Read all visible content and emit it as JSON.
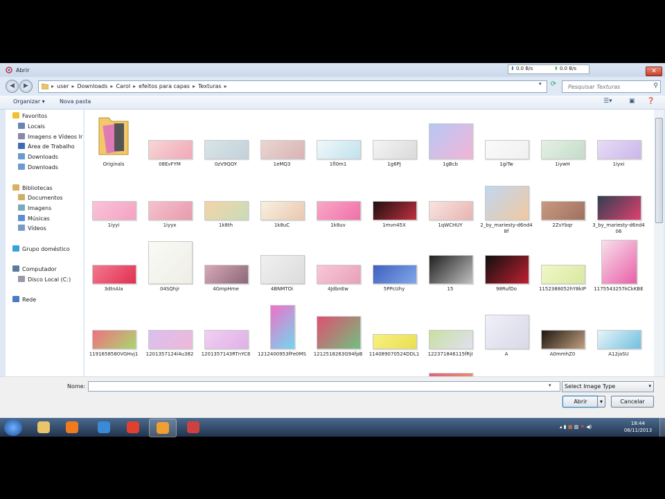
{
  "window": {
    "title": "Abrir",
    "close_glyph": "✕"
  },
  "netmeter": {
    "down": "0.0 B/s",
    "up": "0.0 B/s"
  },
  "nav": {
    "back_glyph": "◀",
    "forward_glyph": "▶"
  },
  "breadcrumbs": [
    "user",
    "Downloads",
    "Carol",
    "efeitos para capas",
    "Texturas"
  ],
  "search": {
    "placeholder": "Pesquisar Texturas"
  },
  "toolbar": {
    "organize": "Organizar",
    "organize_arrow": "▾",
    "new_folder": "Nova pasta"
  },
  "sidebar": [
    {
      "label": "Favoritos",
      "icon": "star-icon",
      "color": "#f0c030",
      "header": true
    },
    {
      "label": "Locais",
      "icon": "places-icon",
      "color": "#6a86b0"
    },
    {
      "label": "Imagens e Vídeos Ir",
      "icon": "images-icon",
      "color": "#88a"
    },
    {
      "label": "Área de Trabalho",
      "icon": "desktop-icon",
      "color": "#3b6bb5"
    },
    {
      "label": "Downloads",
      "icon": "downloads-icon",
      "color": "#6a9ad0"
    },
    {
      "label": "Downloads",
      "icon": "downloads-icon",
      "color": "#6a9ad0"
    },
    {
      "label": "Bibliotecas",
      "icon": "library-icon",
      "color": "#d8b060",
      "header": true
    },
    {
      "label": "Documentos",
      "icon": "documents-icon",
      "color": "#cfae6a"
    },
    {
      "label": "Imagens",
      "icon": "pictures-icon",
      "color": "#7ab"
    },
    {
      "label": "Músicas",
      "icon": "music-icon",
      "color": "#5a8fd0"
    },
    {
      "label": "Vídeos",
      "icon": "videos-icon",
      "color": "#7a9ac0"
    },
    {
      "label": "Grupo doméstico",
      "icon": "homegroup-icon",
      "color": "#3aa0d8",
      "header": true
    },
    {
      "label": "Computador",
      "icon": "computer-icon",
      "color": "#5a7aa0",
      "header": true
    },
    {
      "label": "Disco Local (C:)",
      "icon": "drive-icon",
      "color": "#99a"
    },
    {
      "label": "Rede",
      "icon": "network-icon",
      "color": "#4a7ac8",
      "header": true
    }
  ],
  "files": [
    {
      "name": "Originals",
      "kind": "folder",
      "colors": [
        "#f2c86a",
        "#e07ab5"
      ]
    },
    {
      "name": "08EvFYM",
      "colors": [
        "#f6d6d6",
        "#f2a8b8"
      ]
    },
    {
      "name": "0zV9QOY",
      "colors": [
        "#d8e4e8",
        "#c2d2da"
      ]
    },
    {
      "name": "1eMQ3",
      "colors": [
        "#ead6d0",
        "#d8b4b4"
      ]
    },
    {
      "name": "1fl0m1",
      "colors": [
        "#f0f8fa",
        "#bfe2ec"
      ]
    },
    {
      "name": "1g6PJ",
      "colors": [
        "#f4f4f4",
        "#dadada"
      ]
    },
    {
      "name": "1gBcb",
      "colors": [
        "#b4c8f4",
        "#f4b4d8"
      ]
    },
    {
      "name": "1giTw",
      "colors": [
        "#fafafa",
        "#f0f0f0"
      ]
    },
    {
      "name": "1iywH",
      "colors": [
        "#e4f0e4",
        "#c4dcc8"
      ]
    },
    {
      "name": "1iyxi",
      "colors": [
        "#e8dcf6",
        "#cab6ea"
      ]
    },
    {
      "name": "1iyyi",
      "colors": [
        "#f8c4d8",
        "#f4a2c2"
      ]
    },
    {
      "name": "1iyyx",
      "colors": [
        "#f4c2cc",
        "#e89aae"
      ]
    },
    {
      "name": "1k8th",
      "colors": [
        "#f4d4a8",
        "#c8dcb8"
      ]
    },
    {
      "name": "1k8uC",
      "colors": [
        "#f8f0e0",
        "#e8c8b0"
      ]
    },
    {
      "name": "1k8uv",
      "colors": [
        "#f8a8c8",
        "#f070a8"
      ]
    },
    {
      "name": "1mvn45X",
      "colors": [
        "#201010",
        "#c03040"
      ]
    },
    {
      "name": "1qWCHUY",
      "colors": [
        "#f8e4e0",
        "#e8b4b0"
      ]
    },
    {
      "name": "2_by_mariesty-d6nd48f",
      "colors": [
        "#c0d8f0",
        "#f0c8a0"
      ]
    },
    {
      "name": "2ZvYbqr",
      "colors": [
        "#c89a80",
        "#a07060"
      ]
    },
    {
      "name": "3_by_mariesty-d6nd406",
      "colors": [
        "#304050",
        "#e04070"
      ]
    },
    {
      "name": "3dtnAla",
      "colors": [
        "#f47890",
        "#e03050"
      ]
    },
    {
      "name": "04SQhjr",
      "colors": [
        "#fafaf6",
        "#eeeee6"
      ]
    },
    {
      "name": "4GmpHme",
      "colors": [
        "#d8a8b8",
        "#8a6878"
      ]
    },
    {
      "name": "4BNMTOi",
      "colors": [
        "#f0f0f0",
        "#dcdcdc"
      ]
    },
    {
      "name": "4JdbnEw",
      "colors": [
        "#f8c8d8",
        "#e8a0b8"
      ]
    },
    {
      "name": "5PPcUhy",
      "colors": [
        "#4060c0",
        "#80a8e8"
      ]
    },
    {
      "name": "15",
      "colors": [
        "#202020",
        "#c0c0c0"
      ]
    },
    {
      "name": "98RufDo",
      "colors": [
        "#101010",
        "#c02030"
      ]
    },
    {
      "name": "1152388052hY8kIP",
      "colors": [
        "#f0f8c8",
        "#d8e8a0"
      ]
    },
    {
      "name": "1175543257kCkKBE",
      "colors": [
        "#f8e0ec",
        "#e860a8"
      ]
    },
    {
      "name": "1191658580VGHvj1",
      "colors": [
        "#f07080",
        "#a8d870"
      ]
    },
    {
      "name": "1201357124l4u382",
      "colors": [
        "#d8c0f0",
        "#f0b8d8"
      ]
    },
    {
      "name": "1201357143RTnYC6",
      "colors": [
        "#f0d0f0",
        "#e0b0e8"
      ]
    },
    {
      "name": "1212400953fFe0MS",
      "colors": [
        "#f070c8",
        "#70d8f0"
      ]
    },
    {
      "name": "1212518263G94fpB",
      "colors": [
        "#e05070",
        "#70c080"
      ]
    },
    {
      "name": "114089070524DDL1",
      "colors": [
        "#f8f080",
        "#e8e050"
      ]
    },
    {
      "name": "122371846115fRjI",
      "colors": [
        "#c8e0a0",
        "#e0e0f0"
      ]
    },
    {
      "name": "A",
      "colors": [
        "#f0f0f8",
        "#d8d8e8"
      ]
    },
    {
      "name": "A0mmhZ0",
      "colors": [
        "#201810",
        "#c0a080"
      ]
    },
    {
      "name": "A12jaSU",
      "colors": [
        "#e8f4f8",
        "#70c0e0"
      ]
    },
    {
      "name": "",
      "colors": [
        "#f8f0f4",
        "#e890c0"
      ]
    },
    {
      "name": "",
      "colors": [
        "#e8c8c8",
        "#c89898"
      ]
    },
    {
      "name": "",
      "colors": [
        "#e8c8c0",
        "#c8a0a0"
      ]
    },
    {
      "name": "",
      "colors": [
        "#707070",
        "#a0a0a0"
      ]
    },
    {
      "name": "",
      "colors": [
        "#f0d8d8",
        "#c8e8e8"
      ]
    },
    {
      "name": "",
      "colors": [
        "#f03030",
        "#30c0f0"
      ]
    },
    {
      "name": "",
      "colors": [
        "#e06080",
        "#f0a060"
      ]
    },
    {
      "name": "",
      "colors": [
        "#f8c0b0",
        "#f0a0a0"
      ]
    },
    {
      "name": "",
      "colors": [
        "#f0e0d8",
        "#c84040"
      ]
    },
    {
      "name": "",
      "colors": [
        "#302020",
        "#c02030"
      ]
    }
  ],
  "bottom": {
    "name_label": "Nome:",
    "name_value": "",
    "name_drop": "▾",
    "file_type": "Select Image Type",
    "file_type_arrow": "▾",
    "open": "Abrir",
    "open_arrow": "▾",
    "cancel": "Cancelar"
  },
  "taskbar": {
    "apps": [
      "folder-icon",
      "media-player-icon",
      "ie-icon",
      "chrome-icon",
      "paint-icon",
      "video-icon"
    ],
    "active_index": 4,
    "clock_time": "18:44",
    "clock_date": "08/11/2013"
  }
}
